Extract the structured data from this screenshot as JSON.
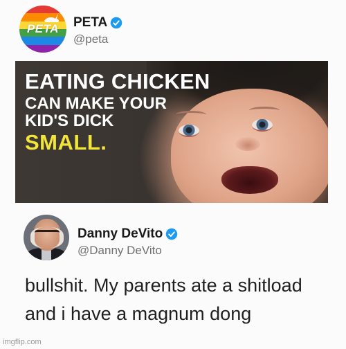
{
  "tweet1": {
    "display_name": "PETA",
    "handle": "@peta",
    "avatar_logo_text": "PETA",
    "verified_icon": "verified-badge-icon",
    "meme": {
      "line1": "EATING CHICKEN",
      "line2": "CAN MAKE YOUR",
      "line3": "KID'S DICK",
      "line4": "SMALL."
    }
  },
  "tweet2": {
    "display_name": "Danny DeVito",
    "handle": "@Danny DeVito",
    "verified_icon": "verified-badge-icon",
    "text_line1": "bullshit. My parents ate a shitload",
    "text_line2": "and i have a magnum dong"
  },
  "watermark": "imgflip.com",
  "colors": {
    "verified_blue": "#1d9bf0",
    "caption_yellow": "#f2e53a",
    "caption_white": "#ffffff"
  }
}
